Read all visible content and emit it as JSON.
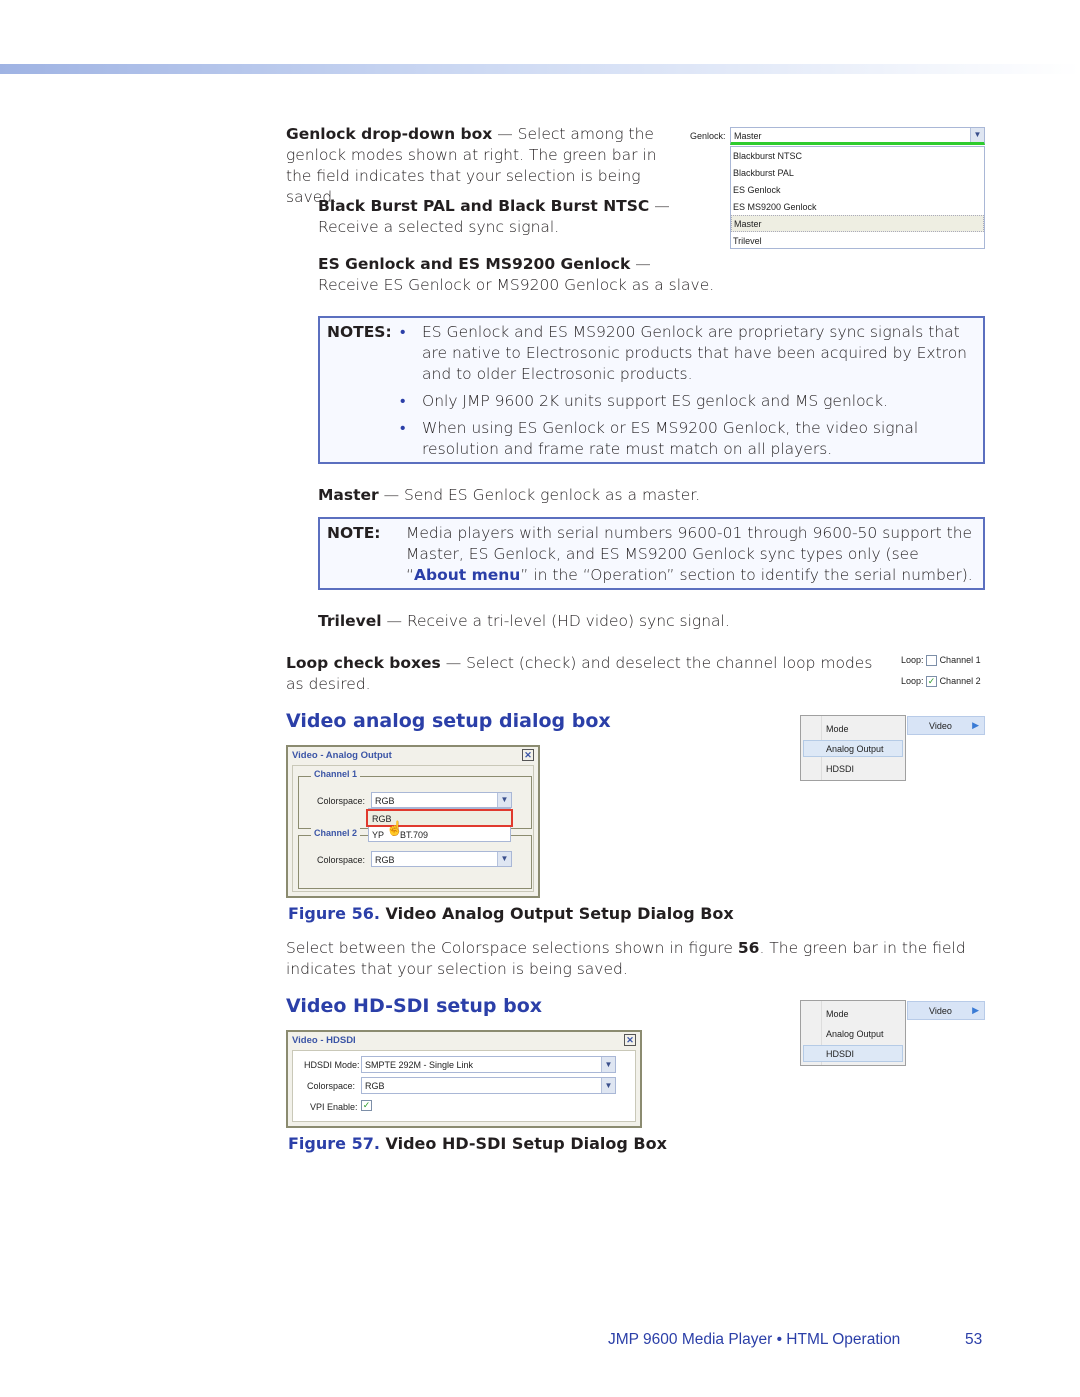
{
  "genlock": {
    "term": "Genlock drop-down box",
    "desc": " — Select among the genlock modes shown at right. The green bar in the field indicates that your selection is being saved.",
    "blackburst_term": "Black Burst PAL and Black Burst NTSC",
    "blackburst_sep": " —",
    "blackburst_desc": "Receive a selected sync signal.",
    "es_term": "ES Genlock and ES MS9200 Genlock",
    "es_sep": " —",
    "es_desc": "Receive ES Genlock or MS9200 Genlock as a slave.",
    "ui": {
      "label": "Genlock:",
      "value": "Master",
      "options": [
        "Blackburst NTSC",
        "Blackburst PAL",
        "ES Genlock",
        "ES MS9200 Genlock",
        "Master",
        "Trilevel"
      ],
      "highlighted": "Master"
    }
  },
  "notes1": {
    "label": "NOTES:",
    "items": [
      "ES Genlock and ES MS9200 Genlock are proprietary sync signals that are native to Electrosonic products that have been acquired by Extron and to older Electrosonic products.",
      "Only JMP 9600 2K units support ES genlock and MS genlock.",
      "When using ES Genlock or ES MS9200 Genlock, the video signal resolution and frame rate must match on all players."
    ]
  },
  "master": {
    "term": "Master",
    "desc": " — Send ES Genlock genlock as a master."
  },
  "note2": {
    "label": "NOTE:",
    "text_a": "Media players with serial numbers 9600-01 through 9600-50 support the Master, ES Genlock, and ES MS9200 Genlock sync types only (see “",
    "link": "About menu",
    "text_b": "” in the “Operation” section to identify the serial number)."
  },
  "trilevel": {
    "term": "Trilevel",
    "desc": " — Receive a tri-level (HD video) sync signal."
  },
  "loop": {
    "term": "Loop check boxes",
    "desc": " — Select (check) and deselect the channel loop modes as desired.",
    "ui": [
      {
        "label": "Loop:",
        "channel": "Channel 1",
        "checked": false
      },
      {
        "label": "Loop:",
        "channel": "Channel 2",
        "checked": true
      }
    ]
  },
  "analog": {
    "heading": "Video analog setup dialog box",
    "dialog": {
      "title": "Video - Analog Output",
      "ch1": "Channel 1",
      "ch2": "Channel 2",
      "cs_label": "Colorspace:",
      "ch1_value": "RGB",
      "ch2_value": "RGB",
      "options": [
        "RGB",
        "YPbPr BT.709"
      ],
      "opt2_visible": "YP",
      "opt2_tail": "BT.709"
    },
    "menu": {
      "top": "Video",
      "items": [
        "Mode",
        "Analog Output",
        "HDSDI"
      ],
      "selected": "Analog Output"
    },
    "fig_num": "Figure 56.",
    "fig_title": " Video Analog Output Setup Dialog Box",
    "body_a": "Select between the Colorspace selections shown in figure ",
    "body_num": "56",
    "body_b": ". The green bar in the field indicates that your selection is being saved."
  },
  "hdsdi": {
    "heading": "Video HD-SDI setup box",
    "dialog": {
      "title": "Video - HDSDI",
      "mode_label": "HDSDI Mode:",
      "mode_value": "SMPTE 292M - Single Link",
      "cs_label": "Colorspace:",
      "cs_value": "RGB",
      "vpi_label": "VPI Enable:",
      "vpi_checked": true
    },
    "menu": {
      "top": "Video",
      "items": [
        "Mode",
        "Analog Output",
        "HDSDI"
      ],
      "selected": "HDSDI"
    },
    "fig_num": "Figure 57.",
    "fig_title": " Video HD-SDI Setup Dialog Box"
  },
  "footer": {
    "title": "JMP 9600 Media Player • HTML Operation",
    "page": "53"
  },
  "colors": {
    "accent": "#2b3fa8",
    "saving_bar": "#2ecc2e",
    "note_border": "#5b6fbf"
  }
}
